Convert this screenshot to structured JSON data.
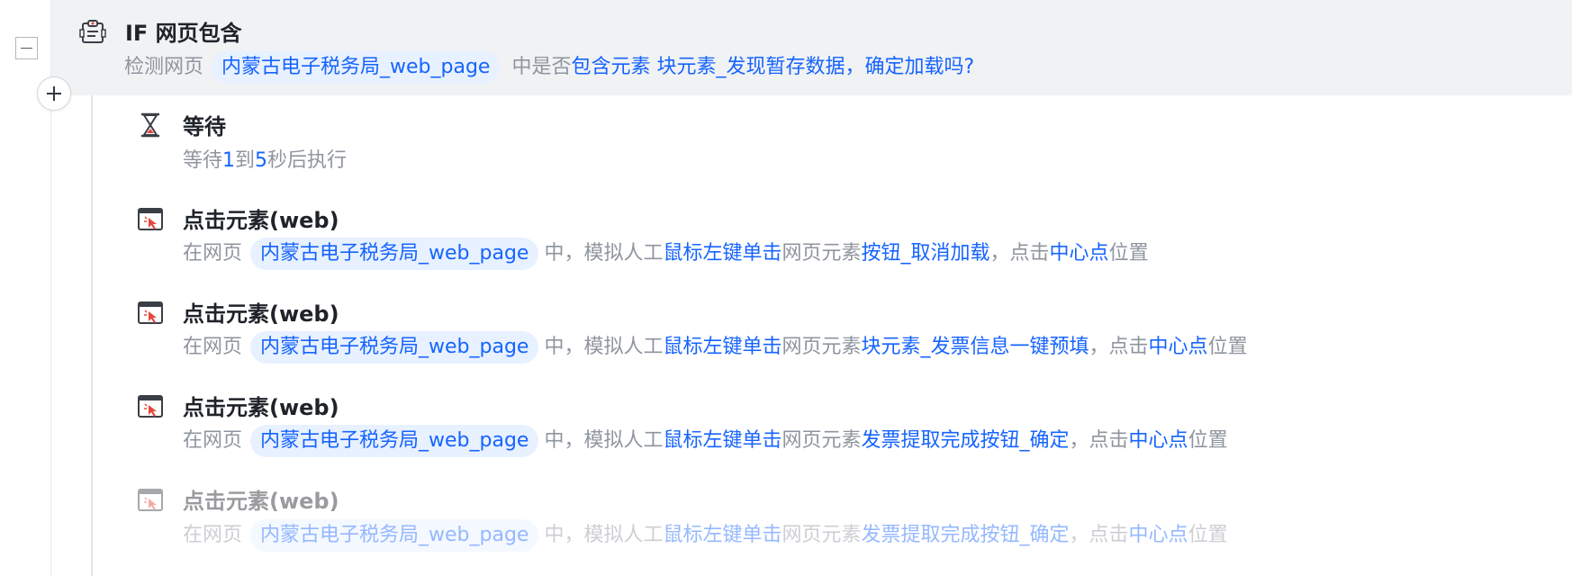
{
  "if_block": {
    "title": "IF 网页包含",
    "desc_prefix": "检测网页",
    "page_name": "内蒙古电子税务局_web_page",
    "desc_mid": "中是否",
    "condition": "包含元素",
    "element": "块元素_发现暂存数据，确定加载吗?"
  },
  "wait_step": {
    "title": "等待",
    "prefix": "等待",
    "min": "1",
    "to": "到",
    "max": "5",
    "suffix": "秒后执行"
  },
  "click_steps": [
    {
      "title": "点击元素(web)",
      "prefix": "在网页",
      "page": "内蒙古电子税务局_web_page",
      "mid1": "中，模拟人工",
      "action": "鼠标左键单击",
      "mid2": "网页元素",
      "element": "按钮_取消加载",
      "mid3": "，点击",
      "position": "中心点",
      "suffix": "位置",
      "disabled": false
    },
    {
      "title": "点击元素(web)",
      "prefix": "在网页",
      "page": "内蒙古电子税务局_web_page",
      "mid1": "中，模拟人工",
      "action": "鼠标左键单击",
      "mid2": "网页元素",
      "element": "块元素_发票信息一键预填",
      "mid3": "，点击",
      "position": "中心点",
      "suffix": "位置",
      "disabled": false
    },
    {
      "title": "点击元素(web)",
      "prefix": "在网页",
      "page": "内蒙古电子税务局_web_page",
      "mid1": "中，模拟人工",
      "action": "鼠标左键单击",
      "mid2": "网页元素",
      "element": "发票提取完成按钮_确定",
      "mid3": "，点击",
      "position": "中心点",
      "suffix": "位置",
      "disabled": false
    },
    {
      "title": "点击元素(web)",
      "prefix": "在网页",
      "page": "内蒙古电子税务局_web_page",
      "mid1": "中，模拟人工",
      "action": "鼠标左键单击",
      "mid2": "网页元素",
      "element": "发票提取完成按钮_确定",
      "mid3": "，点击",
      "position": "中心点",
      "suffix": "位置",
      "disabled": true
    }
  ],
  "icons": {
    "if": "clipboard-check-icon",
    "wait": "hourglass-icon",
    "click": "browser-click-icon",
    "collapse": "minus-icon",
    "add": "plus-icon"
  },
  "colors": {
    "accent": "#1664ff",
    "muted_text": "#8f959e",
    "title_text": "#1f2329",
    "chip_bg": "#e8f1ff",
    "if_bg": "#f1f2f4",
    "click_icon_red": "#e8473c"
  }
}
